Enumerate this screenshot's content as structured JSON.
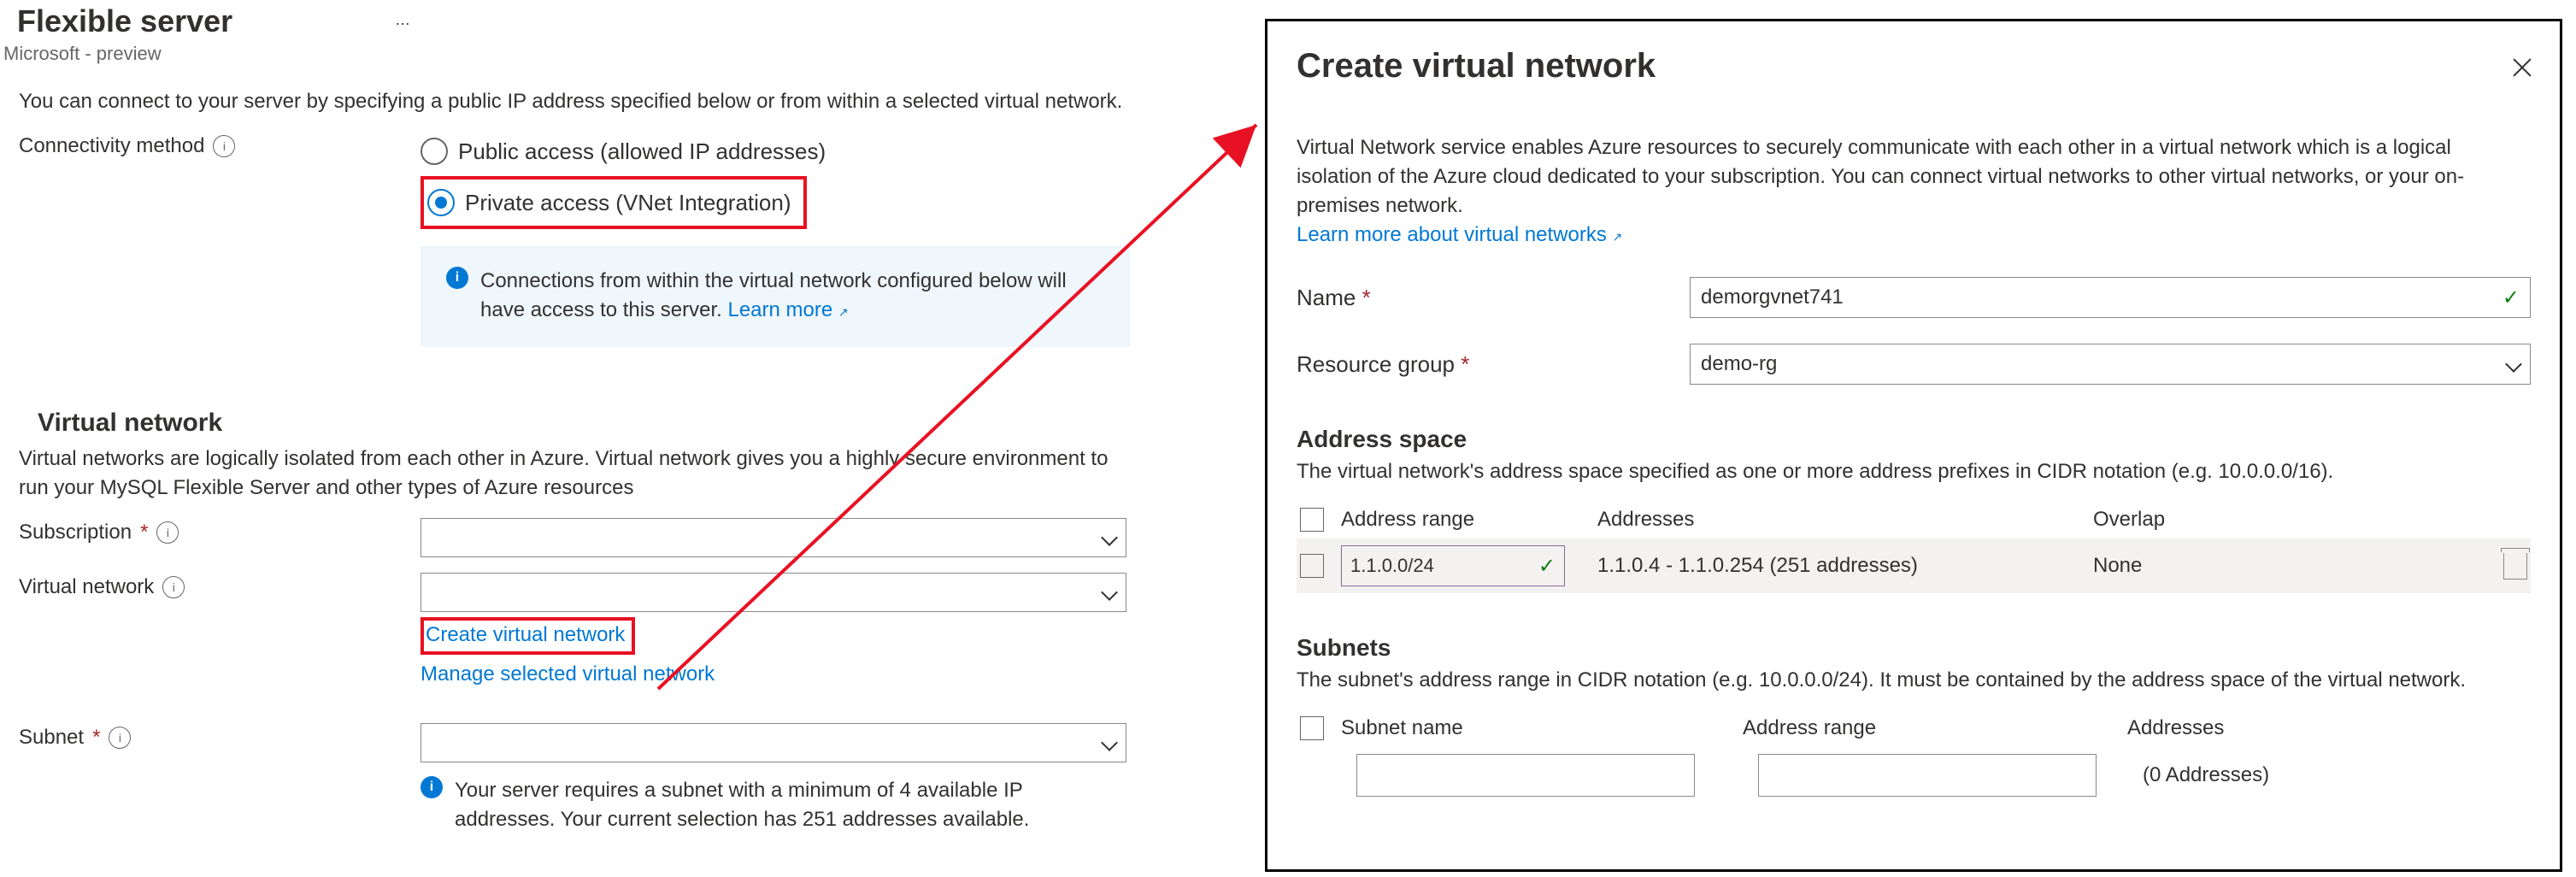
{
  "left": {
    "title": "Flexible server",
    "subtitle": "Microsoft - preview",
    "intro": "You can connect to your server by specifying a public IP address specified below or from within a selected virtual network.",
    "connectivity_label": "Connectivity method",
    "radio_public": "Public access (allowed IP addresses)",
    "radio_private": "Private access (VNet Integration)",
    "note": "Connections from within the virtual network configured below will have access to this server.",
    "learn_more": "Learn more",
    "vnet_heading": "Virtual network",
    "vnet_desc": "Virtual networks are logically isolated from each other in Azure. Virtual network gives you a highly secure environment to run your MySQL Flexible Server and other types of Azure resources",
    "subscription_label": "Subscription",
    "virtual_network_label": "Virtual network",
    "create_vnet_link": "Create virtual network",
    "manage_vnet_link": "Manage selected virtual network",
    "subnet_label": "Subnet",
    "subnet_note": "Your server requires a subnet with a minimum of 4 available IP addresses. Your current selection has 251 addresses available."
  },
  "panel": {
    "title": "Create virtual network",
    "desc": "Virtual Network service enables Azure resources to securely communicate with each other in a virtual network which is a logical isolation of the Azure cloud dedicated to your subscription. You can connect virtual networks to other virtual networks, or your on-premises network.",
    "learn_link": "Learn more about virtual networks",
    "name_label": "Name",
    "name_value": "demorgvnet741",
    "rg_label": "Resource group",
    "rg_value": "demo-rg",
    "addr_heading": "Address space",
    "addr_desc": "The virtual network's address space specified as one or more address prefixes in CIDR notation (e.g. 10.0.0.0/16).",
    "col_range": "Address range",
    "col_addresses": "Addresses",
    "col_overlap": "Overlap",
    "range_value": "1.1.0.0/24",
    "addresses_value": "1.1.0.4 - 1.1.0.254 (251 addresses)",
    "overlap_value": "None",
    "subnets_heading": "Subnets",
    "subnets_desc": "The subnet's address range in CIDR notation (e.g. 10.0.0.0/24). It must be contained by the address space of the virtual network.",
    "col_subnet_name": "Subnet name",
    "col_subnet_range": "Address range",
    "col_subnet_addr": "Addresses",
    "subnet_addr_value": "(0 Addresses)"
  }
}
